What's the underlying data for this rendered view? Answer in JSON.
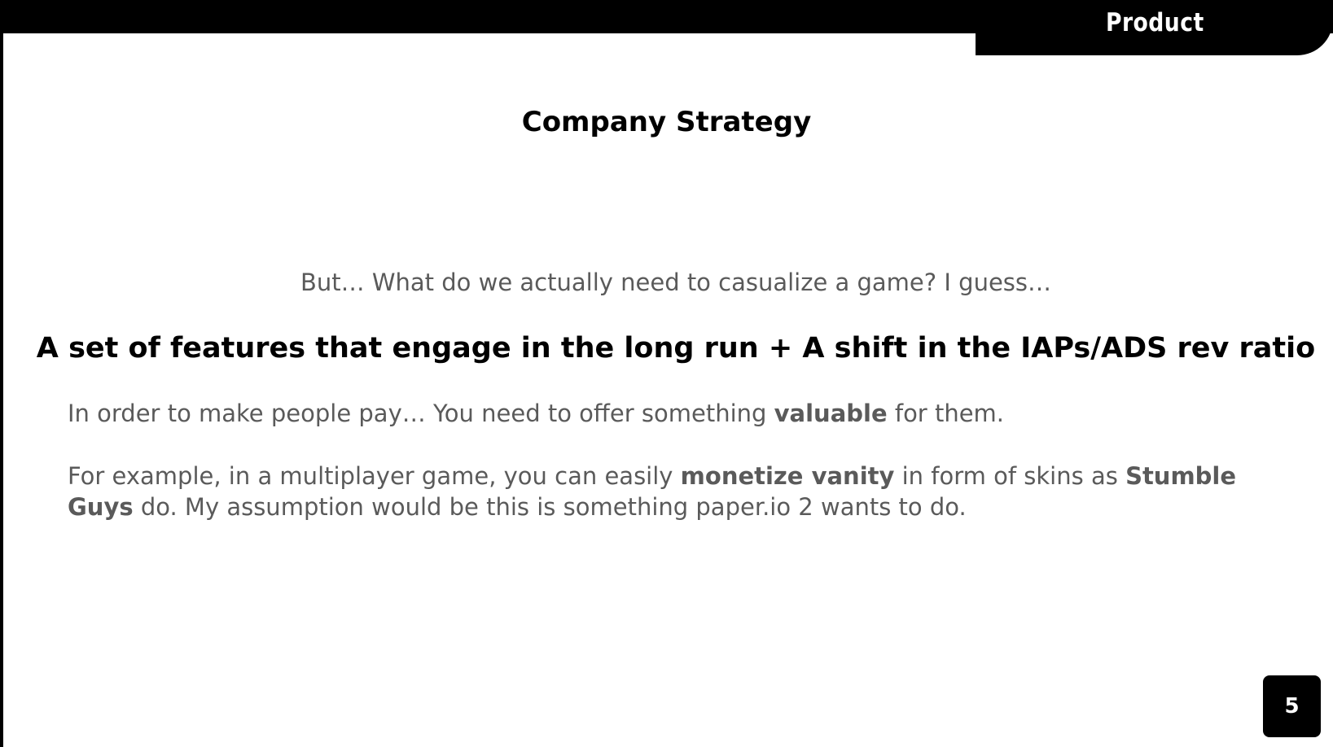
{
  "header": {
    "section_label": "Product"
  },
  "slide": {
    "title": "Company Strategy",
    "lead_question": "But… What do we actually need to casualize a game? I guess…",
    "key_statement": "A set of features that engage in the long run + A shift in the IAPs/ADS rev ratio",
    "paragraph_1": {
      "text_a": "In order to make people pay… You need to offer something ",
      "bold_a": "valuable",
      "text_b": " for them."
    },
    "paragraph_2": {
      "text_a": "For example, in a multiplayer game, you can easily ",
      "bold_a": "monetize vanity",
      "text_b": " in form of skins as ",
      "bold_b": "Stumble Guys",
      "text_c": " do. My assumption would be this is something paper.io 2 wants to do."
    }
  },
  "footer": {
    "page_number": "5"
  },
  "colors": {
    "background": "#ffffff",
    "bars": "#000000",
    "body_text": "#5a5a5a",
    "heading_text": "#000000"
  }
}
